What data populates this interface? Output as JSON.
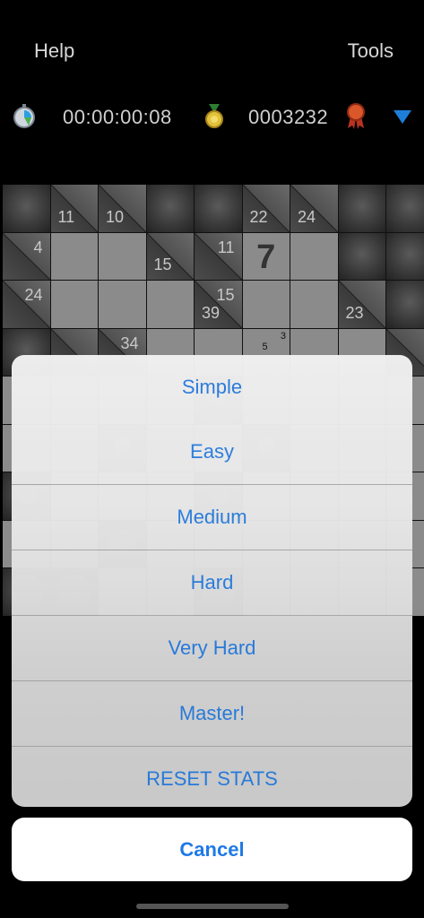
{
  "nav": {
    "help_label": "Help",
    "tools_label": "Tools"
  },
  "status": {
    "timer": "00:00:00:08",
    "score": "0003232",
    "icons": [
      "stopwatch-icon",
      "medal-icon",
      "ribbon-icon",
      "triangle-down-icon"
    ]
  },
  "board": {
    "row1": {
      "c2": "11",
      "c3": "10",
      "c6": "22",
      "c7": "24"
    },
    "row2": {
      "c1": "4",
      "c4": "15",
      "c5": "11",
      "c6": "7"
    },
    "row3": {
      "c1": "24",
      "c5a": "15",
      "c5b": "39",
      "c8": "23"
    },
    "row4": {
      "c3": "34",
      "tiny1": "3",
      "tiny2": "5"
    }
  },
  "sheet": {
    "options": [
      "Simple",
      "Easy",
      "Medium",
      "Hard",
      "Very Hard",
      "Master!",
      "RESET STATS"
    ]
  },
  "cancel_label": "Cancel"
}
